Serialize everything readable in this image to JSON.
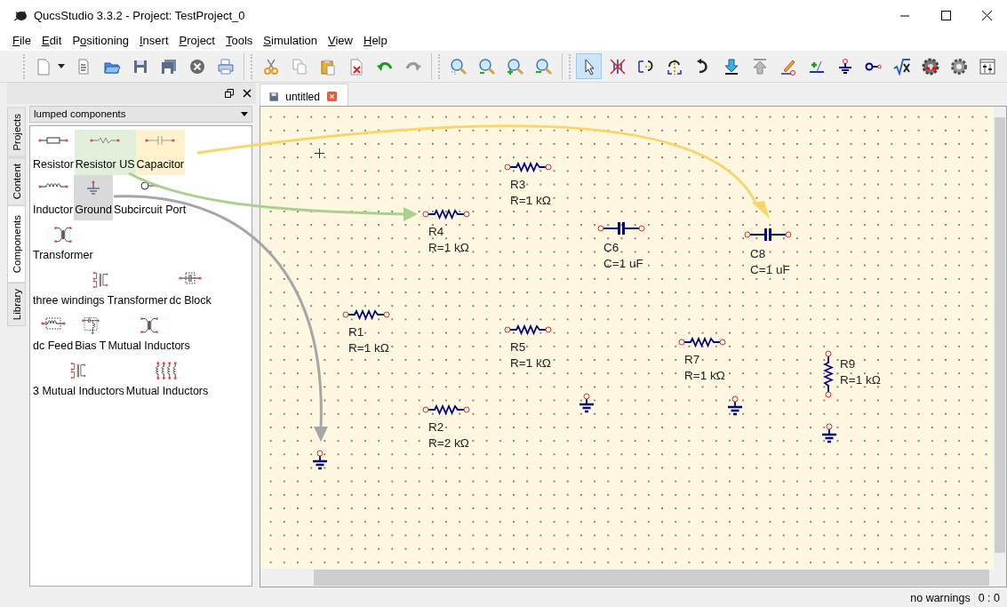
{
  "window": {
    "title": "QucsStudio 3.3.2 - Project: TestProject_0"
  },
  "menu": [
    {
      "mnemonic": "F",
      "rest": "ile"
    },
    {
      "mnemonic": "E",
      "rest": "dit"
    },
    {
      "prefix": "P",
      "mnemonic": "o",
      "rest": "sitioning"
    },
    {
      "mnemonic": "I",
      "rest": "nsert"
    },
    {
      "mnemonic": "P",
      "rest": "roject"
    },
    {
      "mnemonic": "T",
      "rest": "ools"
    },
    {
      "mnemonic": "S",
      "rest": "imulation"
    },
    {
      "mnemonic": "V",
      "rest": "iew"
    },
    {
      "mnemonic": "H",
      "rest": "elp"
    }
  ],
  "toolbar": {
    "groups": [
      {
        "buttons": [
          {
            "kind": "new",
            "selected": false
          },
          {
            "kind": "dropdown",
            "selected": false
          },
          {
            "kind": "text-document",
            "selected": false
          },
          {
            "kind": "open",
            "selected": false
          },
          {
            "kind": "save",
            "selected": false
          },
          {
            "kind": "save-all",
            "selected": false
          },
          {
            "kind": "close",
            "selected": false
          },
          {
            "kind": "print",
            "selected": false
          }
        ]
      },
      {
        "buttons": [
          {
            "kind": "cut",
            "selected": false
          },
          {
            "kind": "copy",
            "selected": false
          },
          {
            "kind": "paste",
            "selected": false
          },
          {
            "kind": "delete",
            "selected": false
          },
          {
            "kind": "undo",
            "selected": false
          },
          {
            "kind": "redo",
            "selected": false
          }
        ]
      },
      {
        "buttons": [
          {
            "kind": "zoom-fit",
            "selected": false
          },
          {
            "kind": "zoom-reset",
            "selected": false
          },
          {
            "kind": "zoom-in",
            "selected": false
          },
          {
            "kind": "zoom-out",
            "selected": false
          }
        ]
      },
      {
        "buttons": [
          {
            "kind": "pointer",
            "selected": true
          },
          {
            "kind": "deactivate",
            "selected": false
          },
          {
            "kind": "mirror-x",
            "selected": false
          },
          {
            "kind": "mirror-y",
            "selected": false
          },
          {
            "kind": "rotate",
            "selected": false
          },
          {
            "kind": "move-down",
            "selected": false
          },
          {
            "kind": "move-up",
            "selected": false
          },
          {
            "kind": "wire",
            "selected": false
          },
          {
            "kind": "wire-label",
            "selected": false
          },
          {
            "kind": "ground",
            "selected": false
          },
          {
            "kind": "port",
            "selected": false
          },
          {
            "kind": "equation",
            "selected": false
          },
          {
            "kind": "dc-simulation",
            "selected": false
          },
          {
            "kind": "simulate",
            "selected": false
          },
          {
            "kind": "tune",
            "selected": false
          }
        ]
      }
    ]
  },
  "dock": {
    "side_tabs": [
      {
        "label": "Projects",
        "selected": false
      },
      {
        "label": "Content",
        "selected": false
      },
      {
        "label": "Components",
        "selected": true
      },
      {
        "label": "Library",
        "selected": false
      }
    ],
    "category": "lumped components",
    "rows": [
      {
        "items": [
          {
            "label": "Resistor",
            "kind": "resistor",
            "color": "#ffffff"
          },
          {
            "label": "Resistor US",
            "kind": "resistor-us",
            "color": "#e2efda"
          },
          {
            "label": "Capacitor",
            "kind": "capacitor",
            "color": "#fff2cc"
          }
        ]
      },
      {
        "items": [
          {
            "label": "Inductor",
            "kind": "inductor",
            "color": "#ffffff"
          },
          {
            "label": "Ground",
            "kind": "ground",
            "color": "#d9d9d9"
          },
          {
            "label": "Subcircuit Port",
            "kind": "port",
            "color": "#ffffff"
          }
        ]
      },
      {
        "items": [
          {
            "label": "Transformer",
            "kind": "transformer",
            "color": "#ffffff"
          }
        ]
      },
      {
        "items": [
          {
            "label": "three windings Transformer",
            "kind": "transformer3",
            "color": "#ffffff"
          },
          {
            "label": "dc Block",
            "kind": "dc-block",
            "color": "#ffffff"
          }
        ]
      },
      {
        "items": [
          {
            "label": "dc Feed",
            "kind": "dc-feed",
            "color": "#ffffff"
          },
          {
            "label": "Bias T",
            "kind": "bias-t",
            "color": "#ffffff"
          },
          {
            "label": "Mutual Inductors",
            "kind": "transformer",
            "color": "#ffffff"
          }
        ]
      },
      {
        "items": [
          {
            "label": "3 Mutual Inductors",
            "kind": "transformer3",
            "color": "#ffffff"
          },
          {
            "label": "Mutual Inductors",
            "kind": "mutual-multi",
            "color": "#ffffff"
          }
        ]
      }
    ]
  },
  "document_tabs": [
    {
      "label": "untitled",
      "selected": true
    }
  ],
  "schematic": {
    "parts": [
      {
        "kind": "resistor",
        "name": "R3",
        "value": "R=1 kΩ"
      },
      {
        "kind": "resistor",
        "name": "R4",
        "value": "R=1 kΩ"
      },
      {
        "kind": "capacitor",
        "name": "C6",
        "value": "C=1 uF"
      },
      {
        "kind": "capacitor",
        "name": "C8",
        "value": "C=1 uF"
      },
      {
        "kind": "resistor",
        "name": "R1",
        "value": "R=1 kΩ"
      },
      {
        "kind": "resistor",
        "name": "R5",
        "value": "R=1 kΩ"
      },
      {
        "kind": "resistor",
        "name": "R7",
        "value": "R=1 kΩ"
      },
      {
        "kind": "resistor-vertical",
        "name": "R9",
        "value": "R=1 kΩ"
      },
      {
        "kind": "ground"
      },
      {
        "kind": "ground"
      },
      {
        "kind": "resistor",
        "name": "R2",
        "value": "R=2 kΩ"
      },
      {
        "kind": "ground"
      },
      {
        "kind": "ground"
      }
    ]
  },
  "arrows": [
    {
      "color": "#f9d66c"
    },
    {
      "color": "#a9d18e"
    },
    {
      "color": "#a6a6a6"
    }
  ],
  "status_bar": {
    "message": "no warnings",
    "position": "0 : 0"
  }
}
